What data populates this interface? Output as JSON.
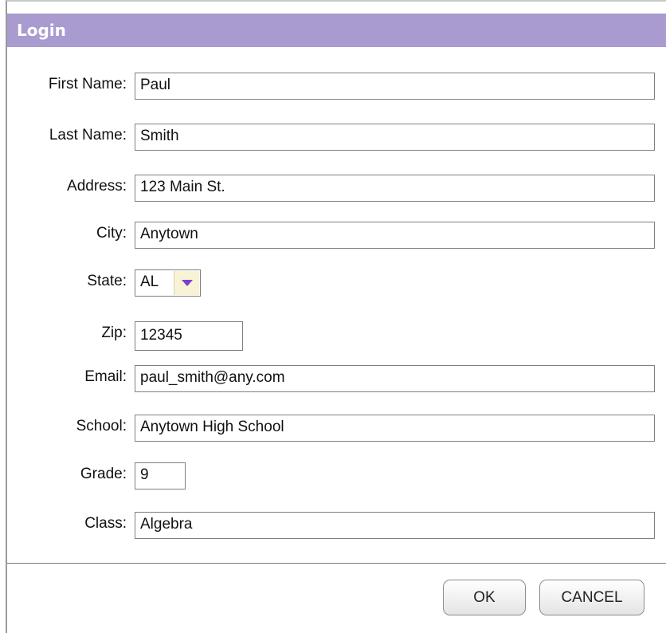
{
  "dialog": {
    "title": "Login"
  },
  "form": {
    "first_name": {
      "label": "First Name:",
      "value": "Paul"
    },
    "last_name": {
      "label": "Last Name:",
      "value": "Smith"
    },
    "address": {
      "label": "Address:",
      "value": "123 Main St."
    },
    "city": {
      "label": "City:",
      "value": "Anytown"
    },
    "state": {
      "label": "State:",
      "value": "AL"
    },
    "zip": {
      "label": "Zip:",
      "value": "12345"
    },
    "email": {
      "label": "Email:",
      "value": "paul_smith@any.com"
    },
    "school": {
      "label": "School:",
      "value": "Anytown High School"
    },
    "grade": {
      "label": "Grade:",
      "value": "9"
    },
    "class": {
      "label": "Class:",
      "value": "Algebra"
    }
  },
  "buttons": {
    "ok": "OK",
    "cancel": "CANCEL"
  },
  "colors": {
    "titlebar": "#a99ad0",
    "dropdown_arrow": "#7a3fd0",
    "dropdown_button": "#f7f3d4"
  },
  "icons": {
    "state_dropdown": "chevron-down-icon"
  }
}
